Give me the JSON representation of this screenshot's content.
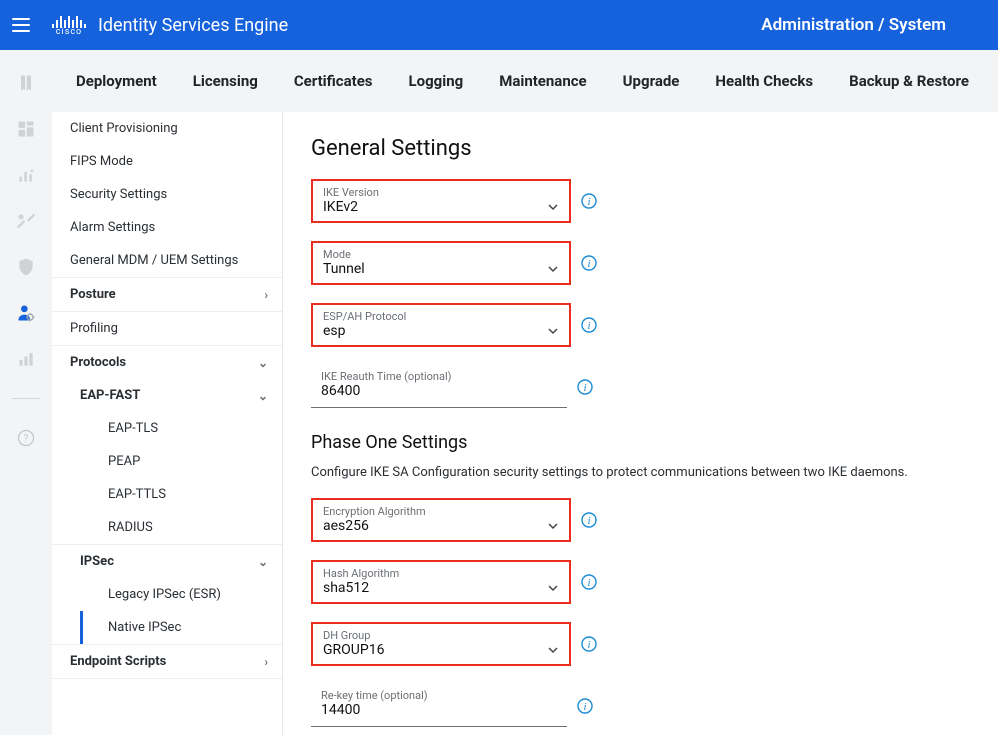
{
  "branding": {
    "vendor": "cisco",
    "product": "Identity Services Engine"
  },
  "breadcrumb": "Administration / System",
  "tabs": [
    "Deployment",
    "Licensing",
    "Certificates",
    "Logging",
    "Maintenance",
    "Upgrade",
    "Health Checks",
    "Backup & Restore"
  ],
  "sidenav": {
    "items_top": [
      "Client Provisioning",
      "FIPS Mode",
      "Security Settings",
      "Alarm Settings",
      "General MDM / UEM Settings"
    ],
    "posture_label": "Posture",
    "profiling_label": "Profiling",
    "protocols_label": "Protocols",
    "eapfast_label": "EAP-FAST",
    "eap_children": [
      "EAP-TLS",
      "PEAP",
      "EAP-TTLS",
      "RADIUS"
    ],
    "ipsec_label": "IPSec",
    "ipsec_children": [
      "Legacy IPSec (ESR)",
      "Native IPSec"
    ],
    "active": "Native IPSec",
    "endpoint_scripts_label": "Endpoint Scripts"
  },
  "content": {
    "general_title": "General Settings",
    "phase1_title": "Phase One Settings",
    "phase1_desc": "Configure IKE SA Configuration security settings to protect communications between two IKE daemons.",
    "fields": {
      "ike_version": {
        "label": "IKE Version",
        "value": "IKEv2",
        "highlight": true,
        "dropdown": true,
        "info": true
      },
      "mode": {
        "label": "Mode",
        "value": "Tunnel",
        "highlight": true,
        "dropdown": true,
        "info": true
      },
      "esp_ah": {
        "label": "ESP/AH Protocol",
        "value": "esp",
        "highlight": true,
        "dropdown": true,
        "info": true
      },
      "ike_reauth": {
        "label": "IKE Reauth Time (optional)",
        "value": "86400",
        "highlight": false,
        "dropdown": false,
        "info": true
      },
      "enc_algo": {
        "label": "Encryption Algorithm",
        "value": "aes256",
        "highlight": true,
        "dropdown": true,
        "info": true
      },
      "hash_algo": {
        "label": "Hash Algorithm",
        "value": "sha512",
        "highlight": true,
        "dropdown": true,
        "info": true
      },
      "dh_group": {
        "label": "DH Group",
        "value": "GROUP16",
        "highlight": true,
        "dropdown": true,
        "info": true
      },
      "rekey": {
        "label": "Re-key time (optional)",
        "value": "14400",
        "highlight": false,
        "dropdown": false,
        "info": true
      }
    }
  }
}
